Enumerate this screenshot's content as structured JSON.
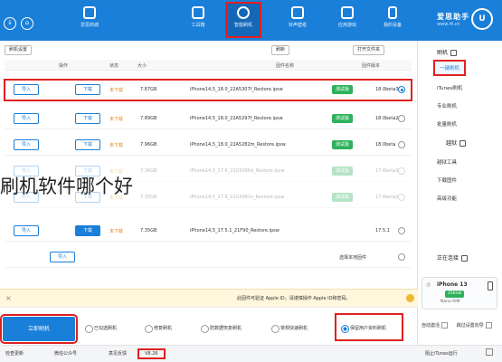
{
  "app": {
    "logo_top": "爱思助手",
    "logo_sub": "www.i4.cn",
    "nav": [
      "我的设备",
      "应用游戏",
      "铃声壁纸",
      "智能刷机",
      "工具箱",
      "爱思商城"
    ],
    "active_nav": "智能刷机"
  },
  "toolbar": {
    "refresh": "刷新",
    "open_folder": "打开文件夹",
    "settings": "刷机设置"
  },
  "columns": {
    "radio": "固件版本",
    "version": "",
    "fname": "固件名称",
    "size": "大小",
    "status": "状态",
    "action": "操作"
  },
  "rows": [
    {
      "version": "18.0beta3",
      "badge": "测试版",
      "fname": "iPhone14,5_18.0_22A5307f_Restore.ipsw",
      "size": "7.87GB",
      "status": "未下载",
      "dl": "下载",
      "imp": "导入",
      "selected": true
    },
    {
      "version": "18.0beta2",
      "badge": "测试版",
      "fname": "iPhone14,5_18.0_22A5297f_Restore.ipsw",
      "size": "7.89GB",
      "status": "未下载",
      "dl": "下载",
      "imp": "导入",
      "selected": false
    },
    {
      "version": "18.0beta",
      "badge": "测试版",
      "fname": "iPhone14,5_18.0_22A5282m_Restore.ipsw",
      "size": "7.96GB",
      "status": "未下载",
      "dl": "下载",
      "imp": "导入",
      "selected": false
    },
    {
      "version": "17.6beta3",
      "badge": "测试版",
      "fname": "iPhone14,5_17.6_21G5066d_Restore.ipsw",
      "size": "7.36GB",
      "status": "未下载",
      "dl": "下载",
      "imp": "导入",
      "selected": false
    },
    {
      "version": "17.6beta2",
      "badge": "测试版",
      "fname": "iPhone14,5_17.6_21G5061e_Restore.ipsw",
      "size": "7.35GB",
      "status": "未下载",
      "dl": "下载",
      "imp": "导入",
      "selected": false
    },
    {
      "version": "17.5.1",
      "badge": "",
      "fname": "iPhone14,5_17.5.1_21F90_Restore.ipsw",
      "size": "7.35GB",
      "status": "未下载",
      "dl": "下载",
      "imp": "导入",
      "selected": false
    },
    {
      "version": "选择本地固件",
      "badge": "",
      "fname": "",
      "size": "",
      "status": "",
      "dl": "",
      "imp": "导入",
      "selected": false
    }
  ],
  "overlay_text": "刷机软件哪个好",
  "notice": {
    "close": "×",
    "msg": "此固件可验证 Apple ID，请谨慎操作 Apple ID和密码。"
  },
  "bottom": {
    "flash_btn": "立即刷机",
    "modes": [
      "保留用户资料刷机",
      "常规快速刷机",
      "防数据恢复刷机",
      "修复刷机",
      "已勾选刷机"
    ],
    "active_mode": "保留用户资料刷机"
  },
  "statusbar": {
    "left_check": "阻止iTunes运行",
    "version": "V8.26",
    "feedback": "意见反馈",
    "wechat": "微信公众号",
    "update": "检查更新"
  },
  "side": {
    "group1": "刷机",
    "items1": [
      "一键刷机",
      "iTunes刷机",
      "专业刷机",
      "批量刷机"
    ],
    "group2": "越狱",
    "items2": [
      "越狱工具",
      "下载固件",
      "高级功能"
    ],
    "selected": "一键刷机",
    "group3": "正在连接",
    "device_name": "iPhone 13",
    "device_cap": "256GB",
    "device_bat": "Nano-SIM",
    "auto_activate": "自动激活",
    "skip_guide": "跳过设置向导"
  }
}
